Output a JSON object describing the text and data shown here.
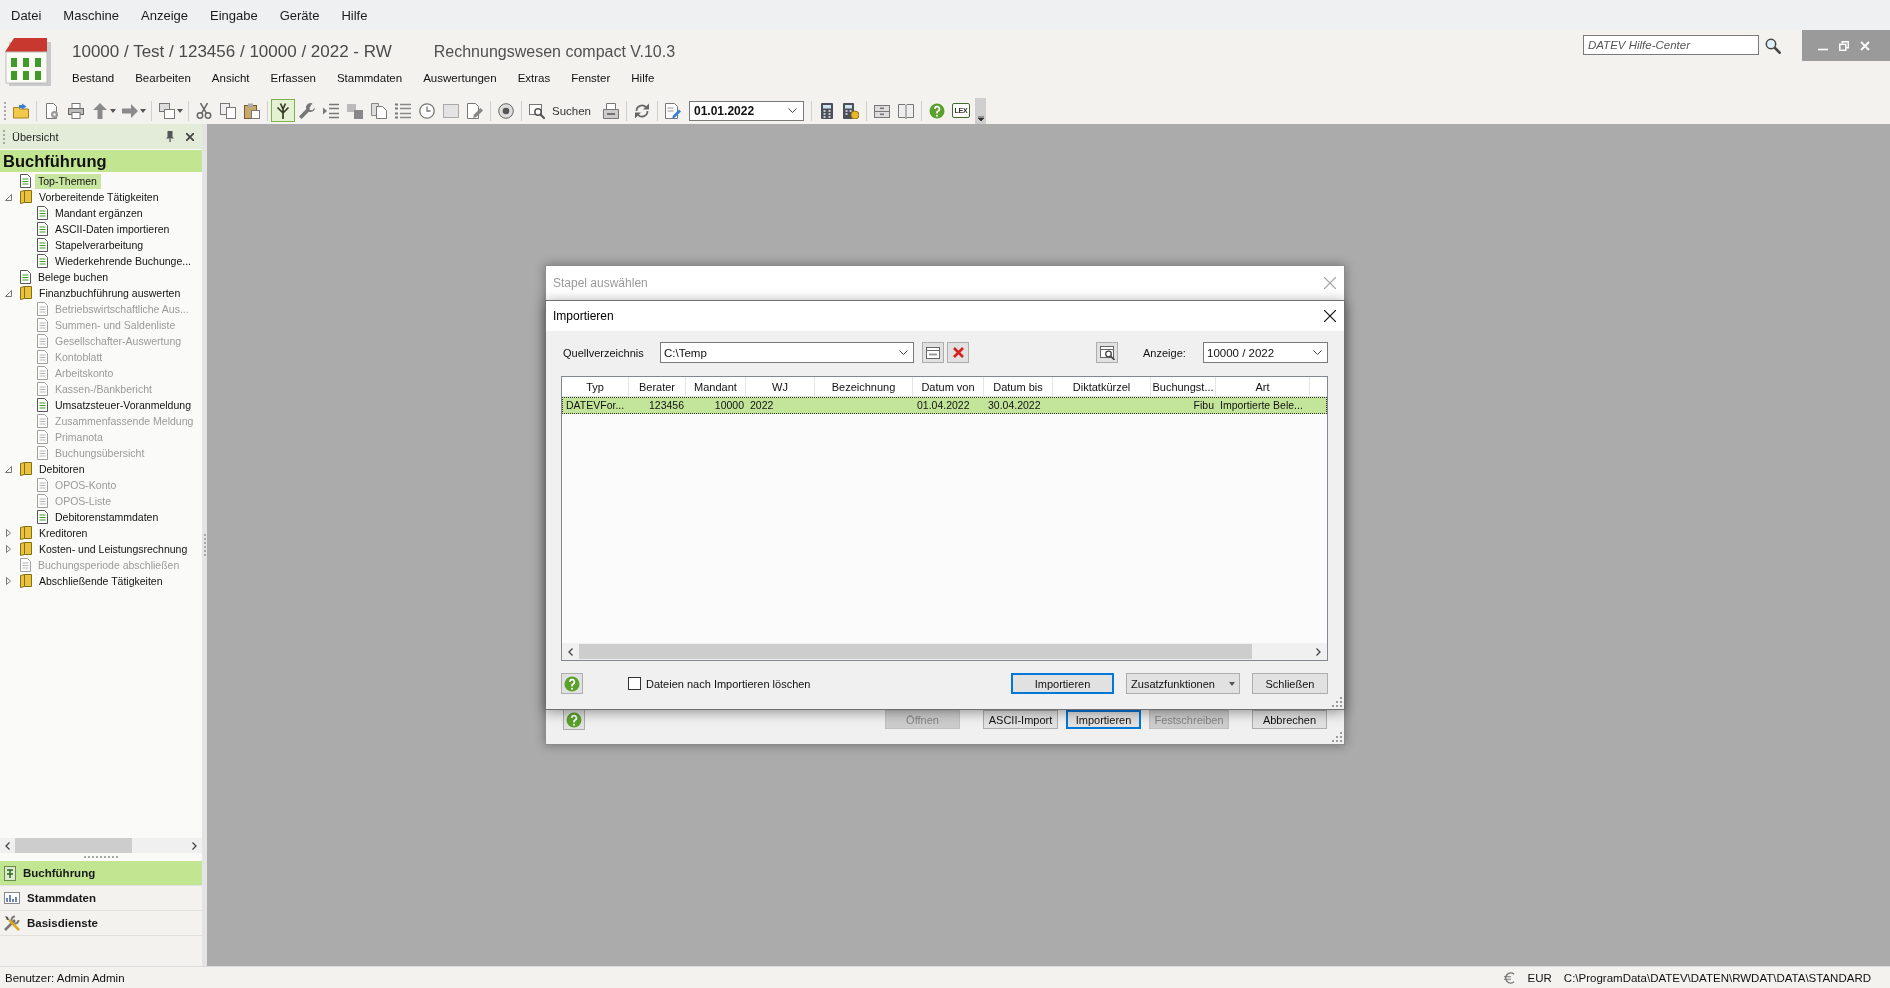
{
  "menubar": [
    "Datei",
    "Maschine",
    "Anzeige",
    "Eingabe",
    "Geräte",
    "Hilfe"
  ],
  "header": {
    "title": "10000 / Test / 123456 / 10000 / 2022 - RW",
    "product": "Rechnungswesen compact V.10.3",
    "menu": [
      "Bestand",
      "Bearbeiten",
      "Ansicht",
      "Erfassen",
      "Stammdaten",
      "Auswertungen",
      "Extras",
      "Fenster",
      "Hilfe"
    ],
    "help_search": {
      "placeholder": "DATEV Hilfe-Center"
    }
  },
  "toolbar": {
    "tree_button": {
      "selected": true
    },
    "search_button": {
      "label": "Suchen"
    },
    "date_field": {
      "value": "01.01.2022"
    },
    "lex_button": {
      "label": "LEX"
    }
  },
  "sidebar": {
    "panel_title": "Übersicht",
    "heading": "Buchführung",
    "tree": [
      {
        "kind": "page",
        "label": "Top-Themen",
        "selected": true,
        "disabled": false
      },
      {
        "kind": "folder",
        "label": "Vorbereitende Tätigkeiten",
        "selected": false,
        "expanded": true,
        "children": [
          {
            "kind": "page",
            "label": "Mandant ergänzen",
            "selected": false,
            "disabled": false
          },
          {
            "kind": "page",
            "label": "ASCII-Daten importieren",
            "selected": false,
            "disabled": false
          },
          {
            "kind": "page",
            "label": "Stapelverarbeitung",
            "selected": false,
            "disabled": false
          },
          {
            "kind": "page",
            "label": "Wiederkehrende Buchunge...",
            "selected": false,
            "disabled": false
          }
        ]
      },
      {
        "kind": "page",
        "label": "Belege buchen",
        "selected": false,
        "disabled": false
      },
      {
        "kind": "folder",
        "label": "Finanzbuchführung auswerten",
        "selected": false,
        "expanded": true,
        "children": [
          {
            "kind": "page",
            "label": "Betriebswirtschaftliche Aus...",
            "selected": false,
            "disabled": true
          },
          {
            "kind": "page",
            "label": "Summen- und Saldenliste",
            "selected": false,
            "disabled": true
          },
          {
            "kind": "page",
            "label": "Gesellschafter-Auswertung",
            "selected": false,
            "disabled": true
          },
          {
            "kind": "page",
            "label": "Kontoblatt",
            "selected": false,
            "disabled": true
          },
          {
            "kind": "page",
            "label": "Arbeitskonto",
            "selected": false,
            "disabled": true
          },
          {
            "kind": "page",
            "label": "Kassen-/Bankbericht",
            "selected": false,
            "disabled": true
          },
          {
            "kind": "page",
            "label": "Umsatzsteuer-Voranmeldung",
            "selected": false,
            "disabled": false
          },
          {
            "kind": "page",
            "label": "Zusammenfassende Meldung",
            "selected": false,
            "disabled": true
          },
          {
            "kind": "page",
            "label": "Primanota",
            "selected": false,
            "disabled": true
          },
          {
            "kind": "page",
            "label": "Buchungsübersicht",
            "selected": false,
            "disabled": true
          }
        ]
      },
      {
        "kind": "folder",
        "label": "Debitoren",
        "selected": false,
        "expanded": true,
        "children": [
          {
            "kind": "page",
            "label": "OPOS-Konto",
            "selected": false,
            "disabled": true
          },
          {
            "kind": "page",
            "label": "OPOS-Liste",
            "selected": false,
            "disabled": true
          },
          {
            "kind": "page",
            "label": "Debitorenstammdaten",
            "selected": false,
            "disabled": false
          }
        ]
      },
      {
        "kind": "folder",
        "label": "Kreditoren",
        "selected": false,
        "expanded": false
      },
      {
        "kind": "folder",
        "label": "Kosten- und Leistungsrechnung",
        "selected": false,
        "expanded": false
      },
      {
        "kind": "page",
        "label": "Buchungsperiode abschließen",
        "selected": false,
        "disabled": true
      },
      {
        "kind": "folder",
        "label": "Abschließende Tätigkeiten",
        "selected": false,
        "expanded": false
      }
    ],
    "nav": [
      {
        "label": "Buchführung",
        "selected": true
      },
      {
        "label": "Stammdaten",
        "selected": false
      },
      {
        "label": "Basisdienste",
        "selected": false
      }
    ]
  },
  "stapel_dialog": {
    "title": "Stapel auswählen",
    "active": false,
    "buttons": [
      {
        "label": "Öffnen",
        "disabled": true,
        "focused": false
      },
      {
        "label": "ASCII-Import",
        "disabled": false,
        "focused": false
      },
      {
        "label": "Importieren",
        "disabled": false,
        "focused": true
      },
      {
        "label": "Festschreiben",
        "disabled": true,
        "focused": false
      },
      {
        "label": "Abbrechen",
        "disabled": false,
        "focused": false
      }
    ]
  },
  "import_dialog": {
    "title": "Importieren",
    "source": {
      "label": "Quellverzeichnis",
      "value": "C:\\Temp"
    },
    "display": {
      "label": "Anzeige:",
      "value": "10000 / 2022"
    },
    "table": {
      "columns": [
        "Typ",
        "Berater",
        "Mandant",
        "WJ",
        "Bezeichnung",
        "Datum von",
        "Datum bis",
        "Diktatkürzel",
        "Buchungst...",
        "Art"
      ],
      "rows": [
        {
          "selected": true,
          "cells": [
            "DATEVFor...",
            "123456",
            "10000",
            "2022",
            null,
            "01.04.2022",
            "30.04.2022",
            null,
            "Fibu",
            "Importierte Bele..."
          ]
        }
      ]
    },
    "delete_option": {
      "label": "Dateien nach Importieren löschen",
      "checked": false
    },
    "buttons": [
      {
        "label": "Importieren",
        "kind": "plain",
        "focused": true
      },
      {
        "label": "Zusatzfunktionen",
        "kind": "menu",
        "focused": false
      },
      {
        "label": "Schließen",
        "kind": "plain",
        "focused": false
      }
    ]
  },
  "status_bar": {
    "user": "Benutzer: Admin Admin",
    "currency": "EUR",
    "path": "C:\\ProgramData\\DATEV\\DATEN\\RWDAT\\DATA\\STANDARD"
  }
}
